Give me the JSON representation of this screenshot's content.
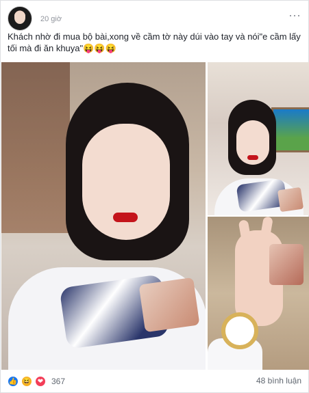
{
  "post": {
    "time": "20 giờ",
    "more_icon": "⋯",
    "caption": "Khách nhờ đi mua bộ bài,xong về cầm tờ này dúi vào tay và nói\"e cầm lấy tối mà đi ăn khuya\"😝😝😝",
    "reactions": {
      "icons": [
        "👍",
        "😆",
        "❤"
      ],
      "count": "367"
    },
    "comments": "48 bình luận"
  },
  "colors": {
    "border": "#dddfe2",
    "secondary_text": "#90949c",
    "like_blue": "#1877f2",
    "love_red": "#f33e58",
    "haha_yellow": "#f7b125"
  }
}
